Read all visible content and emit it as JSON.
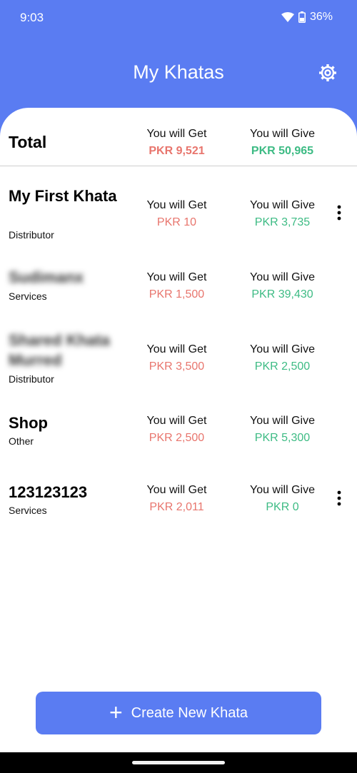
{
  "status_bar": {
    "time": "9:03",
    "battery": "36%"
  },
  "header": {
    "title": "My Khatas"
  },
  "labels": {
    "get": "You will Get",
    "give": "You will Give"
  },
  "total": {
    "label": "Total",
    "get": "PKR 9,521",
    "give": "PKR 50,965"
  },
  "khatas": [
    {
      "name": "My First Khata",
      "type": "Distributor",
      "get": "PKR 10",
      "give": "PKR 3,735"
    },
    {
      "name": "Sudimanx",
      "type": "Services",
      "get": "PKR 1,500",
      "give": "PKR 39,430"
    },
    {
      "name": "Shared Khata Murred",
      "type": "Distributor",
      "get": "PKR 3,500",
      "give": "PKR 2,500"
    },
    {
      "name": "Shop",
      "type": "Other",
      "get": "PKR 2,500",
      "give": "PKR 5,300"
    },
    {
      "name": "123123123",
      "type": "Services",
      "get": "PKR 2,011",
      "give": "PKR 0"
    }
  ],
  "create_button": {
    "label": "Create New Khata"
  },
  "colors": {
    "primary": "#5a7cf2",
    "get_red": "#e8756d",
    "give_green": "#3dbb84"
  }
}
